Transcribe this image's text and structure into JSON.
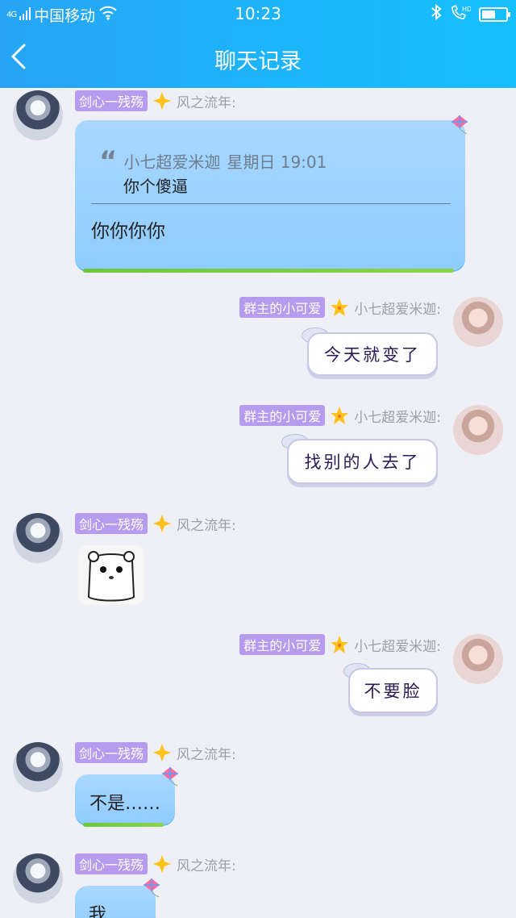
{
  "status_bar": {
    "net": "4G",
    "carrier": "中国移动",
    "time": "10:23"
  },
  "header": {
    "title": "聊天记录"
  },
  "messages": [
    {
      "badge": "剑心一残殇",
      "name": "风之流年:",
      "quote_author": "小七超爱米迦",
      "quote_time": "星期日 19:01",
      "quote_text": "你个傻逼",
      "text": "你你你你"
    },
    {
      "badge": "群主的小可爱",
      "name": "小七超爱米迦:",
      "text": "今天就变了"
    },
    {
      "badge": "群主的小可爱",
      "name": "小七超爱米迦:",
      "text": "找别的人去了"
    },
    {
      "badge": "剑心一残殇",
      "name": "风之流年:"
    },
    {
      "badge": "群主的小可爱",
      "name": "小七超爱米迦:",
      "text": "不要脸"
    },
    {
      "badge": "剑心一残殇",
      "name": "风之流年:",
      "text": "不是……"
    },
    {
      "badge": "剑心一残殇",
      "name": "风之流年:",
      "text": "我……"
    }
  ]
}
